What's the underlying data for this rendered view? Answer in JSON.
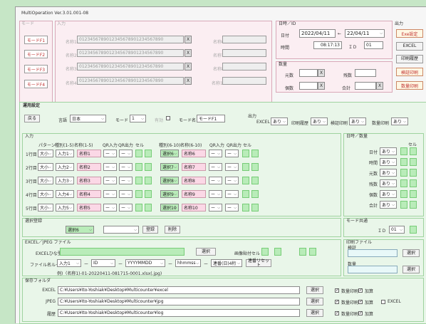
{
  "title": "MultiOperation Ver.3.01.001-08",
  "mode_section": {
    "label": "モード",
    "buttons": [
      "モードF1",
      "モードF2",
      "モードF3",
      "モードF4"
    ]
  },
  "input_section": {
    "label": "入力",
    "rows": [
      {
        "name_label": "名称1",
        "value": "0123456789012345678901234567890",
        "right_label": "名称6"
      },
      {
        "name_label": "名称2",
        "value": "0123456789012345678901234567890",
        "right_label": "名称7"
      },
      {
        "name_label": "名称3",
        "value": "0123456789012345678901234567890",
        "right_label": "名称8"
      },
      {
        "name_label": "名称4",
        "value": "0123456789012345678901234567890",
        "right_label": "名称10"
      }
    ],
    "clear": "X"
  },
  "datetime": {
    "label": "日時／ID",
    "date_label": "日付",
    "date_from": "2022/04/11",
    "arrow": "←",
    "date_to": "22/04/11",
    "time_label": "時間",
    "time": "08:17:13",
    "id_label": "ＩＤ",
    "id": "01"
  },
  "quantity": {
    "label": "数量",
    "genka_label": "元数",
    "tansu_label": "残数",
    "kosu_label": "個数",
    "gokei_label": "合計",
    "clear": "X"
  },
  "output": {
    "label": "出力",
    "buttons": [
      "Exe設定",
      "EXCEL",
      "印刷履歴",
      "検証印刷",
      "数量印刷"
    ]
  },
  "settings": {
    "label": "運用設定",
    "back": "戻る",
    "lang_label": "言語",
    "lang": "日本",
    "mode_label": "モード",
    "mode": "1",
    "enable_label": "有効",
    "mode_name_label": "モード名",
    "mode_name": "モードF1",
    "out_label": "出力",
    "excel_label": "EXCEL",
    "excel_val": "あり",
    "print_hist_label": "印刷履歴",
    "print_hist_val": "あり",
    "verify_label": "検証印刷",
    "verify_val": "あり",
    "qty_print_label": "数量印刷",
    "qty_print_val": "あり"
  },
  "input_cfg": {
    "label": "入力",
    "headers": [
      "パターン",
      "種別(1-5)",
      "名称(1-5)",
      "QR入力",
      "QR出力",
      "セル",
      "種別(6-10)",
      "名称(6-10)",
      "QR入力",
      "QR出力",
      "セル"
    ],
    "rows": [
      {
        "row": "1行目",
        "pattern": "大小",
        "type": "入力1",
        "name": "名称1",
        "qrin": "ー",
        "qrout": "ー",
        "type2": "選択6",
        "name2": "名称6",
        "qrin2": "ー",
        "qrout2": "ー"
      },
      {
        "row": "2行目",
        "pattern": "大小",
        "type": "入力2",
        "name": "名称2",
        "qrin": "ー",
        "qrout": "ー",
        "type2": "選択7",
        "name2": "名称7",
        "qrin2": "ー",
        "qrout2": "ー"
      },
      {
        "row": "3行目",
        "pattern": "大小",
        "type": "入力3",
        "name": "名称3",
        "qrin": "ー",
        "qrout": "ー",
        "type2": "選択8",
        "name2": "名称8",
        "qrin2": "ー",
        "qrout2": "ー"
      },
      {
        "row": "4行目",
        "pattern": "大小",
        "type": "入力4",
        "name": "名称4",
        "qrin": "ー",
        "qrout": "ー",
        "type2": "選択9",
        "name2": "名称9",
        "qrin2": "ー",
        "qrout2": "ー"
      },
      {
        "row": "5行目",
        "pattern": "大小",
        "type": "入力5",
        "name": "名称5",
        "qrin": "ー",
        "qrout": "ー",
        "type2": "選択10",
        "name2": "名称10",
        "qrin2": "ー",
        "qrout2": "ー"
      }
    ]
  },
  "dt_cfg": {
    "label": "日時／数量",
    "cell_header": "セル",
    "rows": [
      {
        "label": "日付",
        "val": "あり"
      },
      {
        "label": "時間",
        "val": "あり"
      },
      {
        "label": "元数",
        "val": "あり"
      },
      {
        "label": "残数",
        "val": "あり"
      },
      {
        "label": "個数",
        "val": "あり"
      },
      {
        "label": "合計",
        "val": "あり"
      }
    ]
  },
  "select_reg": {
    "label": "選択登録",
    "sel": "選択6",
    "register": "登録",
    "delete": "削除"
  },
  "mode_common": {
    "label": "モード共通",
    "id_label": "ＩＤ",
    "id": "01"
  },
  "excel": {
    "label": "EXCEL／JPEG ファイル",
    "template_label": "EXCELひな型",
    "select": "選択",
    "img_cell_label": "画像貼付セル",
    "rule_label": "ファイル名ルール",
    "rule1": "入力1",
    "rule2": "ID",
    "rule3": "YYYYMMDD",
    "rule4": "hhmmss",
    "rule5": "連番(日)4桁",
    "reset": "連番リセット",
    "example": "例)（名称1)-01-20220411-081715-0001.xlsx(.jpg)"
  },
  "print_file": {
    "label": "印刷ファイル",
    "verify_label": "検証",
    "select": "選択",
    "qty_label": "数量"
  },
  "save": {
    "label": "保存フォルダ",
    "rows": [
      {
        "label": "EXCEL",
        "path": "C:¥Users¥Ito-Yoshiak¥Desktop¥Multicounter¥excel",
        "select": "選択",
        "c1": "数量印刷",
        "c2": "加算"
      },
      {
        "label": "JPEG",
        "path": "C:¥Users¥Ito-Yoshiak¥Desktop¥Multicounter¥jpg",
        "select": "選択",
        "c1": "数量印刷",
        "c2": "加算",
        "c3": "EXCEL"
      },
      {
        "label": "履歴",
        "path": "C:¥Users¥Ito-Yoshiak¥Desktop¥Multicounter¥log",
        "select": "選択",
        "c1": "数量印刷",
        "c2": "加算"
      }
    ]
  },
  "icons": {
    "dropdown": "chevron-down-icon",
    "close": "close-icon"
  }
}
